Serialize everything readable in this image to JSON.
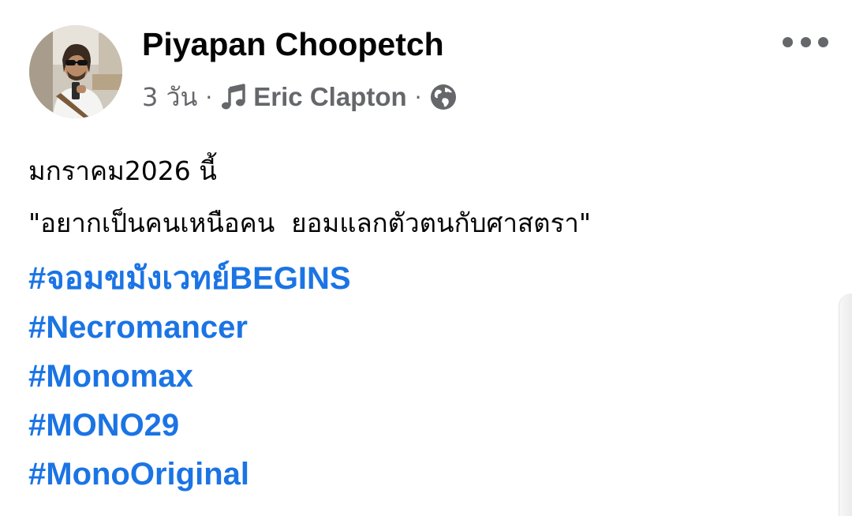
{
  "post": {
    "author": "Piyapan Choopetch",
    "time": "3 วัน",
    "separator": "·",
    "song": "Eric Clapton",
    "icons": {
      "avatar": "profile-photo",
      "music": "music-note-icon",
      "privacy": "globe-icon",
      "more": "more-options-icon"
    },
    "text_lines": [
      "มกราคม2026 นี้",
      "\"อยากเป็นคนเหนือคน  ยอมแลกตัวตนกับศาสตรา\""
    ],
    "hashtags": [
      "#จอมขมังเวทย์BEGINS",
      "#Necromancer",
      "#Monomax",
      "#MONO29",
      "#MonoOriginal"
    ]
  },
  "colors": {
    "link": "#1b74e4",
    "meta": "#65676b",
    "text": "#050505"
  }
}
